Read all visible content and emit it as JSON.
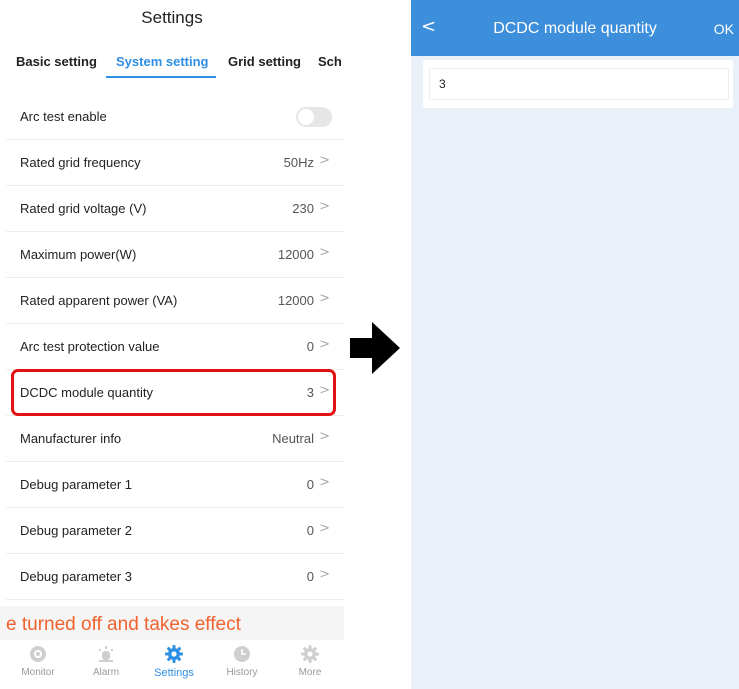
{
  "left": {
    "title": "Settings",
    "tabs": [
      {
        "label": "Basic setting",
        "active": false
      },
      {
        "label": "System setting",
        "active": true
      },
      {
        "label": "Grid setting",
        "active": false
      },
      {
        "label": "Sch",
        "active": false
      }
    ],
    "rows": [
      {
        "label": "Arc test enable",
        "value": "",
        "toggle": true
      },
      {
        "label": "Rated grid frequency",
        "value": "50Hz"
      },
      {
        "label": "Rated grid voltage (V)",
        "value": "230"
      },
      {
        "label": "Maximum power(W)",
        "value": "12000"
      },
      {
        "label": "Rated apparent power (VA)",
        "value": "12000"
      },
      {
        "label": "Arc test protection value",
        "value": "0"
      },
      {
        "label": "DCDC module quantity",
        "value": "3"
      },
      {
        "label": "Manufacturer info",
        "value": "Neutral"
      },
      {
        "label": "Debug parameter 1",
        "value": "0"
      },
      {
        "label": "Debug parameter 2",
        "value": "0"
      },
      {
        "label": "Debug parameter 3",
        "value": "0"
      }
    ],
    "chevron": ">",
    "notice": "e turned off and takes effect",
    "tabbar": [
      {
        "label": "Monitor",
        "icon": "monitor-icon"
      },
      {
        "label": "Alarm",
        "icon": "alarm-icon"
      },
      {
        "label": "Settings",
        "icon": "settings-gear-icon",
        "active": true
      },
      {
        "label": "History",
        "icon": "history-clock-icon"
      },
      {
        "label": "More",
        "icon": "more-gear-icon"
      }
    ]
  },
  "right": {
    "back": "<",
    "title": "DCDC module quantity",
    "ok": "OK",
    "input_value": "3"
  },
  "colors": {
    "accent": "#2f8fe3",
    "header": "#3d8fdc",
    "highlight": "#e31212",
    "notice": "#f0622f"
  }
}
